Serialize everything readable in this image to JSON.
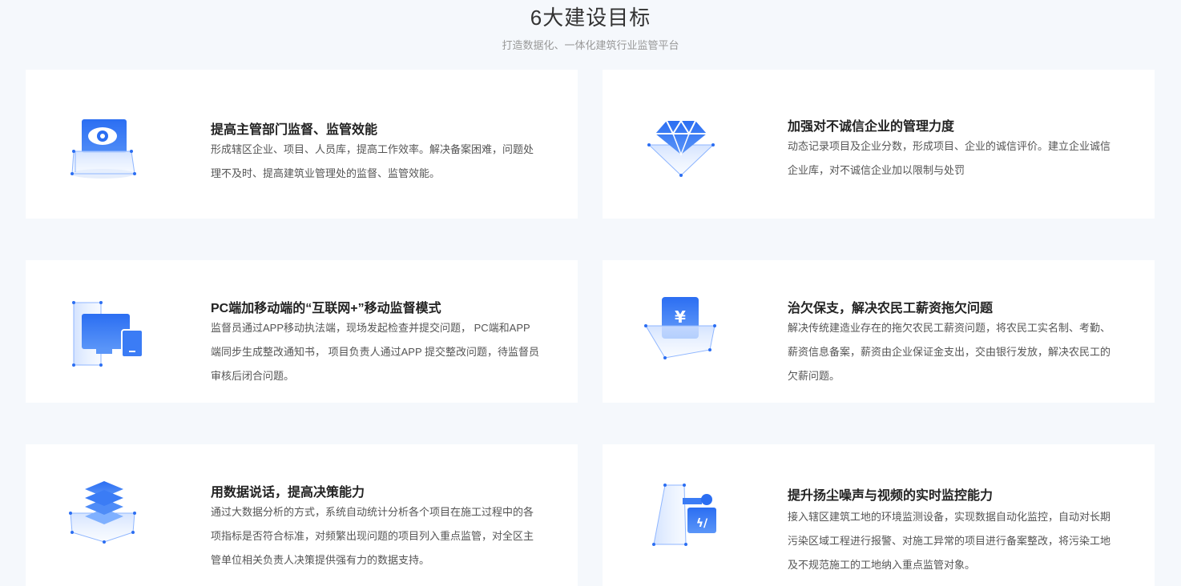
{
  "section": {
    "title": "6大建设目标",
    "subtitle": "打造数据化、一体化建筑行业监管平台"
  },
  "colors": {
    "accent": "#2b6ef2",
    "accent_light": "#7fb0ff",
    "card_bg": "#ffffff",
    "page_bg": "#f5f8fc"
  },
  "cards": [
    {
      "icon": "eye-monitor-icon",
      "title": "提高主管部门监督、监管效能",
      "desc": "形成辖区企业、项目、人员库，提高工作效率。解决备案困难，问题处理不及时、提高建筑业管理处的监督、监管效能。"
    },
    {
      "icon": "diamond-icon",
      "title": "加强对不诚信企业的管理力度",
      "desc": "动态记录项目及企业分数，形成项目、企业的诚信评价。建立企业诚信企业库，对不诚信企业加以限制与处罚"
    },
    {
      "icon": "pc-mobile-devices-icon",
      "title": "PC端加移动端的“互联网+”移动监督模式",
      "desc": "监督员通过APP移动执法端，现场发起检查并提交问题， PC端和APP端同步生成整改通知书， 项目负责人通过APP 提交整改问题，待监督员审核后闭合问题。"
    },
    {
      "icon": "yen-receipt-icon",
      "title": "治欠保支，解决农民工薪资拖欠问题",
      "desc": "解决传统建造业存在的拖欠农民工薪资问题，将农民工实名制、考勤、薪资信息备案，薪资由企业保证金支出，交由银行发放，解决农民工的欠薪问题。"
    },
    {
      "icon": "data-layers-icon",
      "title": "用数据说话，提高决策能力",
      "desc": "通过大数据分析的方式，系统自动统计分析各个项目在施工过程中的各项指标是否符合标准，对频繁出现问题的项目列入重点监管，对全区主管单位相关负责人决策提供强有力的数据支持。"
    },
    {
      "icon": "environment-monitor-icon",
      "title": "提升扬尘噪声与视频的实时监控能力",
      "desc": "接入辖区建筑工地的环境监测设备，实现数据自动化监控，自动对长期污染区域工程进行报警、对施工异常的项目进行备案整改，将污染工地及不规范施工的工地纳入重点监管对象。"
    }
  ]
}
